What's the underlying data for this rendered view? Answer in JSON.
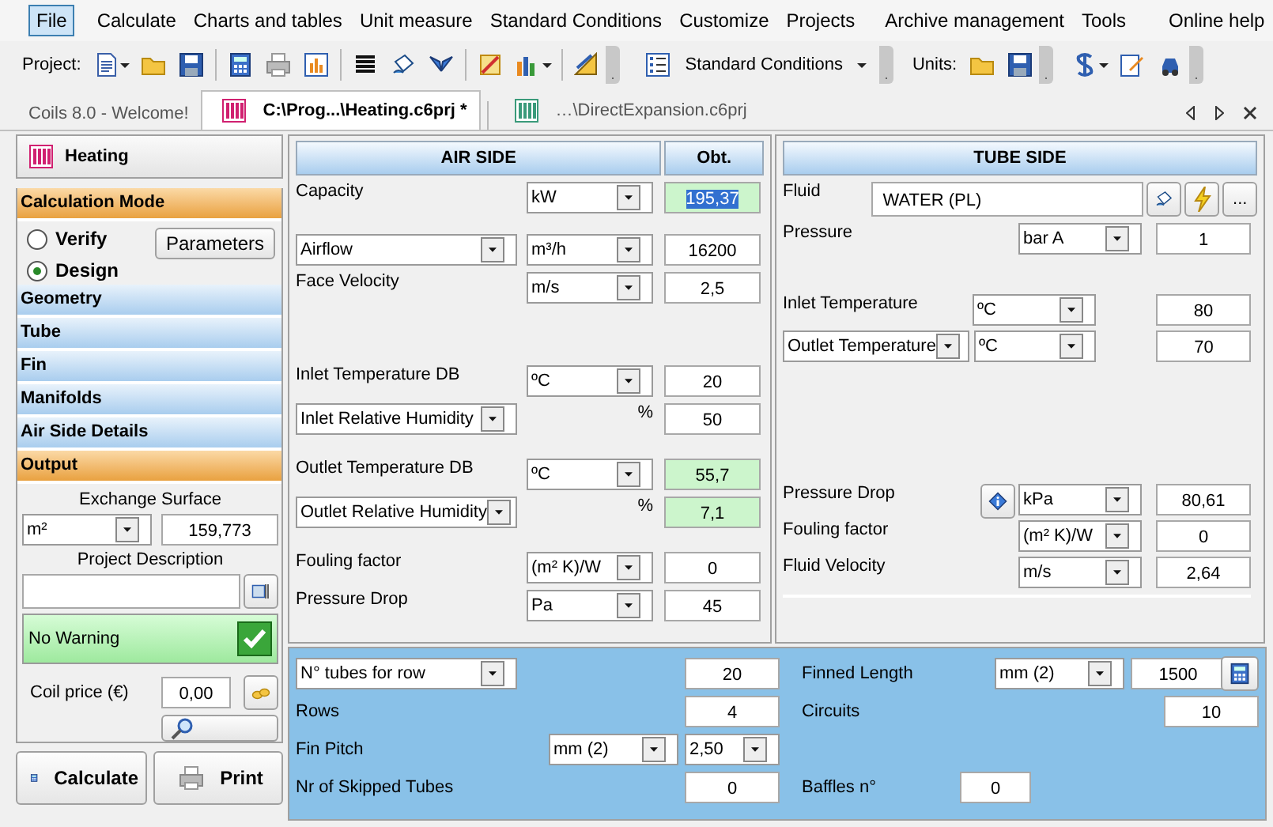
{
  "menu": [
    {
      "label": "File",
      "selected": true
    },
    {
      "label": "Calculate",
      "selected": false
    },
    {
      "label": "Charts and tables",
      "selected": false
    },
    {
      "label": "Unit measure",
      "selected": false
    },
    {
      "label": "Standard Conditions",
      "selected": false
    },
    {
      "label": "Customize",
      "selected": false
    },
    {
      "label": "Projects",
      "selected": false
    },
    {
      "label": "Archive management",
      "selected": false
    },
    {
      "label": "Tools",
      "selected": false
    },
    {
      "label": "Online help",
      "selected": false
    }
  ],
  "toolbar": {
    "project_label": "Project:",
    "conditions_button": "Standard Conditions",
    "units_label": "Units:"
  },
  "tabs": [
    {
      "label": "Coils 8.0 - Welcome!",
      "selected": false,
      "icon": false
    },
    {
      "label": "C:\\Prog...\\Heating.c6prj *",
      "selected": true,
      "icon": true
    },
    {
      "label": "…\\DirectExpansion.c6prj",
      "selected": false,
      "icon": true
    }
  ],
  "sidebar": {
    "title": "Heating",
    "sections": [
      {
        "label": "Calculation Mode",
        "expanded": true,
        "mode": {
          "options": [
            {
              "label": "Verify",
              "selected": false
            },
            {
              "label": "Design",
              "selected": true
            }
          ],
          "parameters_button": "Parameters"
        }
      },
      {
        "label": "Geometry",
        "expanded": false
      },
      {
        "label": "Tube",
        "expanded": false
      },
      {
        "label": "Fin",
        "expanded": false
      },
      {
        "label": "Manifolds",
        "expanded": false
      },
      {
        "label": "Air Side Details",
        "expanded": false
      },
      {
        "label": "Output",
        "expanded": true,
        "output": {
          "surface_label": "Exchange Surface",
          "surface_unit": "m²",
          "surface_value": "159,773",
          "description_label": "Project Description",
          "warning": "No Warning",
          "ok": true,
          "price_label": "Coil price (€)",
          "price_value": "0,00"
        }
      }
    ],
    "calculate_button": "Calculate",
    "print_button": "Print"
  },
  "air_side": {
    "title": "AIR SIDE",
    "column_title": "Obt.",
    "groups": [
      [
        {
          "kind": "plain",
          "label": "Capacity",
          "unit": "kW",
          "value": "195,37",
          "calculated": true,
          "text_selected": true
        }
      ],
      [
        {
          "kind": "choice",
          "label": "Airflow",
          "unit": "m³/h",
          "value": "16200",
          "calculated": false,
          "text_selected": false
        },
        {
          "kind": "plain",
          "label": "Face Velocity",
          "unit": "m/s",
          "value": "2,5",
          "calculated": false,
          "text_selected": false
        }
      ],
      [
        {
          "kind": "plain",
          "label": "Inlet Temperature DB",
          "unit": "ºC",
          "value": "20",
          "calculated": false,
          "text_selected": false
        },
        {
          "kind": "choice",
          "label": "Inlet Relative Humidity",
          "unit_text": "%",
          "value": "50",
          "calculated": false,
          "text_selected": false
        }
      ],
      [
        {
          "kind": "plain",
          "label": "Outlet Temperature DB",
          "unit": "ºC",
          "value": "55,7",
          "calculated": true,
          "text_selected": false
        },
        {
          "kind": "choice",
          "label": "Outlet Relative Humidity",
          "unit_text": "%",
          "value": "7,1",
          "calculated": true,
          "text_selected": false
        }
      ],
      [
        {
          "kind": "plain",
          "label": "Fouling factor",
          "unit": "(m² K)/W",
          "value": "0",
          "calculated": false,
          "text_selected": false
        },
        {
          "kind": "plain",
          "label": "Pressure Drop",
          "unit": "Pa",
          "value": "45",
          "calculated": false,
          "text_selected": false
        }
      ]
    ]
  },
  "tube_side": {
    "title": "TUBE SIDE",
    "fluid_label": "Fluid",
    "fluid_value": "WATER (PL)",
    "fluid_more_button": "...",
    "groups": [
      [
        {
          "kind": "plain",
          "label": "Pressure",
          "unit": "bar A",
          "value": "1"
        }
      ],
      [
        {
          "kind": "plain_inner",
          "label": "Inlet Temperature",
          "unit": "ºC",
          "value": "80"
        },
        {
          "kind": "choice_inner",
          "label": "Outlet Temperature",
          "unit": "ºC",
          "value": "70"
        }
      ],
      [
        {
          "kind": "info",
          "label": "Pressure Drop",
          "unit": "kPa",
          "value": "80,61"
        },
        {
          "kind": "plain",
          "label": "Fouling factor",
          "unit": "(m² K)/W",
          "value": "0"
        },
        {
          "kind": "plain",
          "label": "Fluid Velocity",
          "unit": "m/s",
          "value": "2,64"
        }
      ]
    ]
  },
  "geometry": {
    "left": [
      {
        "kind": "choice",
        "label": "N° tubes for row",
        "value": "20"
      },
      {
        "kind": "plain",
        "label": "Rows",
        "value": "4"
      },
      {
        "kind": "pitch",
        "label": "Fin Pitch",
        "unit": "mm (2)",
        "value": "2,50"
      },
      {
        "kind": "plain",
        "label": "Nr of Skipped Tubes",
        "value": "0"
      }
    ],
    "right": [
      {
        "kind": "length",
        "label": "Finned Length",
        "unit": "mm (2)",
        "value": "1500"
      },
      {
        "kind": "plain",
        "label": "Circuits",
        "value": "10"
      },
      {
        "kind": "short",
        "label": "Baffles n°",
        "value": "0"
      }
    ]
  }
}
